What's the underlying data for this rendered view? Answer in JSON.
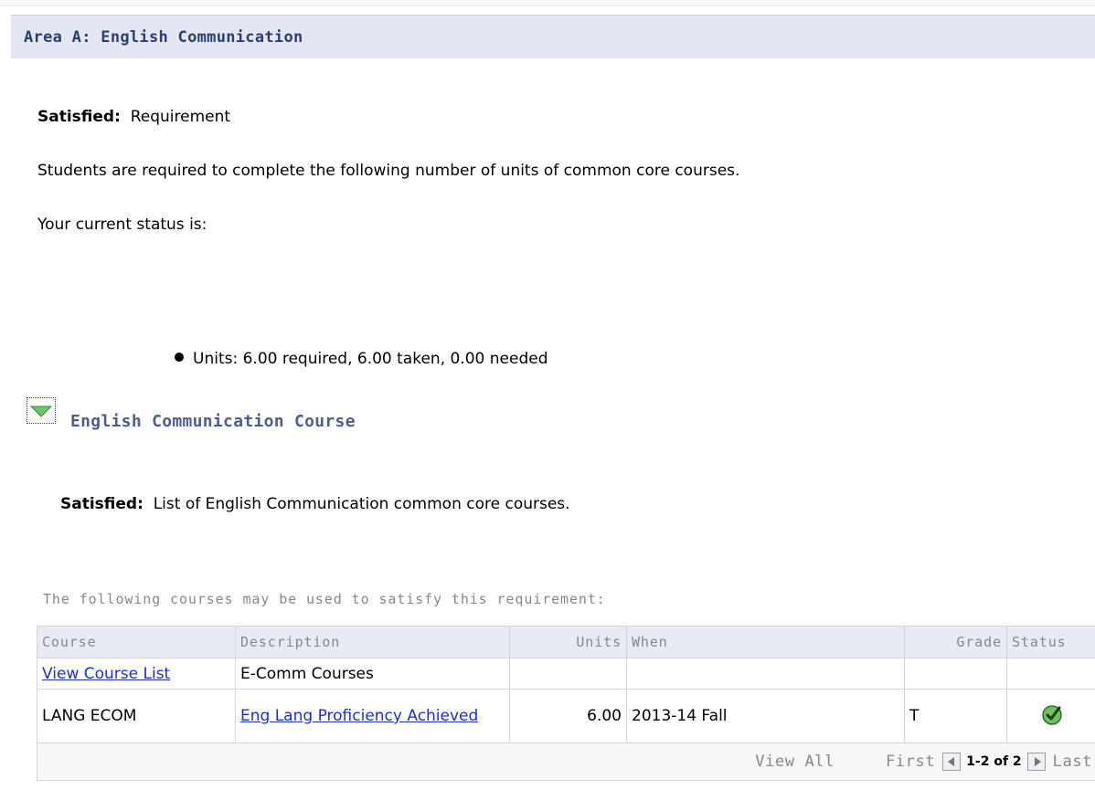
{
  "area": {
    "title": "Area A: English Communication",
    "satisfied_label": "Satisfied:",
    "satisfied_value": "Requirement",
    "description": "Students are required to complete the following number of units of common core courses.",
    "status_intro": "Your current status is:",
    "units_bullet": "Units: 6.00 required, 6.00 taken, 0.00 needed"
  },
  "subsection": {
    "title": "English Communication Course",
    "satisfied_label": "Satisfied:",
    "satisfied_value": "List of English Communication common core courses.",
    "caption": "The following courses may be used to satisfy this requirement:"
  },
  "table": {
    "headers": {
      "course": "Course",
      "description": "Description",
      "units": "Units",
      "when": "When",
      "grade": "Grade",
      "status": "Status"
    },
    "rows": [
      {
        "course": "View Course List",
        "description": "E-Comm Courses",
        "units": "",
        "when": "",
        "grade": "",
        "status": ""
      },
      {
        "course": "LANG ECOM",
        "description": "Eng Lang Proficiency Achieved",
        "units": "6.00",
        "when": "2013-14 Fall",
        "grade": "T",
        "status": "completed"
      }
    ],
    "nav": {
      "view_all": "View All",
      "first": "First",
      "range": "1-2 of 2",
      "last": "Last"
    }
  },
  "colors": {
    "header_bg": "#e2e7f1",
    "header_text": "#2d3f70",
    "link": "#1c2fd0",
    "status_ok": "#3f9a35"
  }
}
